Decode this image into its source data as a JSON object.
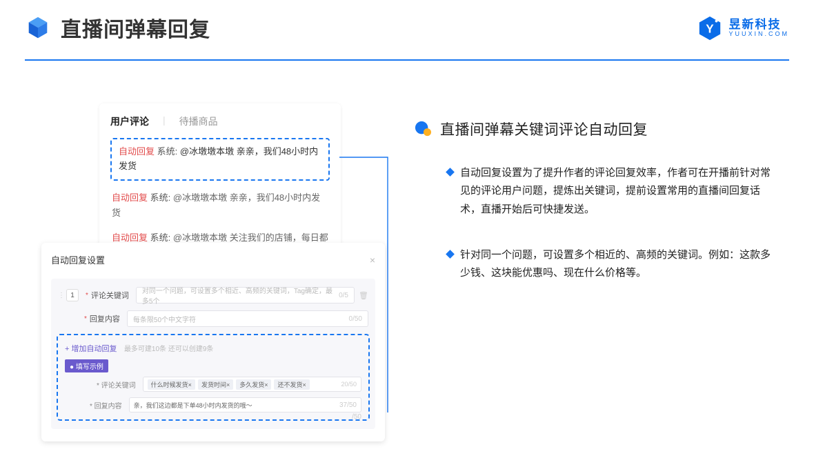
{
  "header": {
    "title": "直播间弹幕回复",
    "brand_cn": "昱新科技",
    "brand_en": "YUUXIN.COM"
  },
  "comments_panel": {
    "tab_active": "用户评论",
    "tab_inactive": "待播商品",
    "highlighted": {
      "badge": "自动回复",
      "sys": "系统:",
      "text": "@冰墩墩本墩 亲亲，我们48小时内发货"
    },
    "rows": [
      {
        "badge": "自动回复",
        "sys": "系统:",
        "text": "@冰墩墩本墩 亲亲，我们48小时内发货"
      },
      {
        "badge": "自动回复",
        "sys": "系统:",
        "text": "@冰墩墩本墩 关注我们的店铺，每日都有热门推荐呦～"
      }
    ]
  },
  "settings_panel": {
    "title": "自动回复设置",
    "row_num": "1",
    "keyword_label": "评论关键词",
    "keyword_placeholder": "对同一个问题，可设置多个相近、高频的关键词，Tag确定，最多5个",
    "keyword_counter": "0/5",
    "content_label": "回复内容",
    "content_placeholder": "每条限50个中文字符",
    "content_counter": "0/50",
    "add_link": "+ 增加自动回复",
    "add_hint": "最多可建10条 还可以创建9条",
    "example_label": "● 填写示例",
    "ex_keyword_label": "* 评论关键词",
    "ex_tags": [
      "什么时候发货×",
      "发货时间×",
      "多久发货×",
      "还不发货×"
    ],
    "ex_tag_counter": "20/50",
    "ex_content_label": "* 回复内容",
    "ex_content_value": "亲，我们这边都是下单48小时内发货的哦～",
    "ex_content_counter": "37/50",
    "ghost_counter": "/50"
  },
  "right": {
    "section_title": "直播间弹幕关键词评论自动回复",
    "bullets": [
      "自动回复设置为了提升作者的评论回复效率，作者可在开播前针对常见的评论用户问题，提炼出关键词，提前设置常用的直播间回复话术，直播开始后可快捷发送。",
      "针对同一个问题，可设置多个相近的、高频的关键词。例如：这款多少钱、这块能优惠吗、现在什么价格等。"
    ]
  }
}
